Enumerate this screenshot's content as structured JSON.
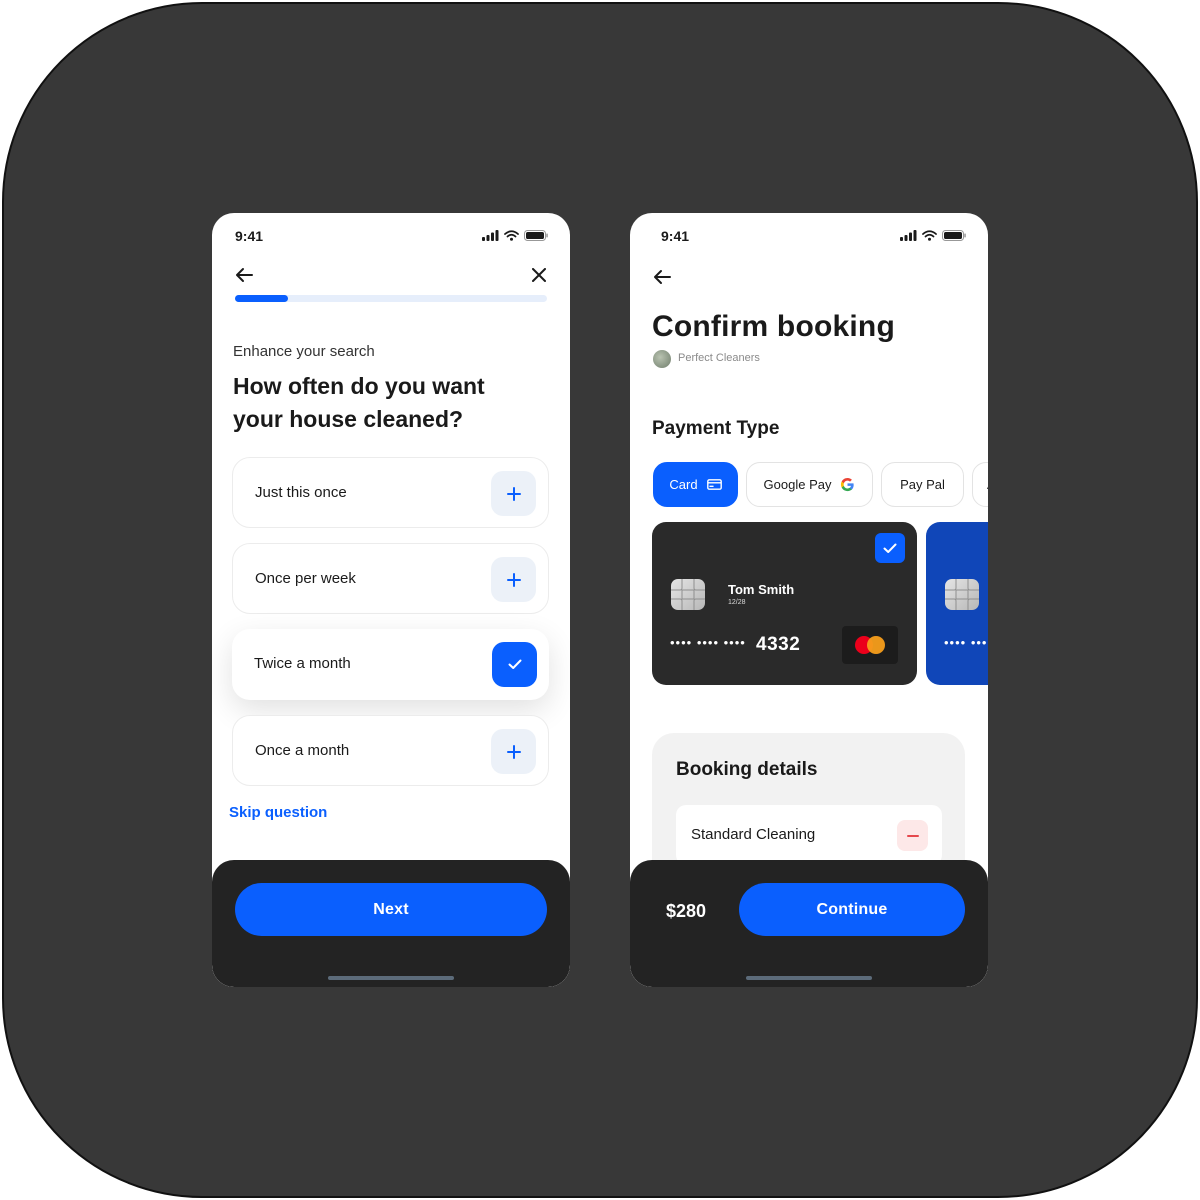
{
  "colors": {
    "accent": "#0a5ffe",
    "dark_panel": "#232323",
    "background": "#383838"
  },
  "left_phone": {
    "status_time": "9:41",
    "progress": 0.17,
    "eyebrow": "Enhance your search",
    "question": "How often do you want your house cleaned?",
    "options": [
      {
        "label": "Just this once",
        "selected": false,
        "icon": "plus-icon"
      },
      {
        "label": "Once per week",
        "selected": false,
        "icon": "plus-icon"
      },
      {
        "label": "Twice a month",
        "selected": true,
        "icon": "check-icon"
      },
      {
        "label": "Once a month",
        "selected": false,
        "icon": "plus-icon"
      }
    ],
    "skip_label": "Skip question",
    "next_label": "Next"
  },
  "right_phone": {
    "status_time": "9:41",
    "title": "Confirm booking",
    "provider": "Perfect Cleaners",
    "payment_section": "Payment Type",
    "payment_tabs": [
      {
        "label": "Card",
        "active": true,
        "icon": "credit-card-icon"
      },
      {
        "label": "Google Pay",
        "active": false,
        "icon": "google-icon"
      },
      {
        "label": "Pay Pal",
        "active": false,
        "icon": ""
      },
      {
        "label": "A",
        "active": false,
        "icon": ""
      }
    ],
    "cards": [
      {
        "holder": "Tom Smith",
        "expiry": "12/28",
        "mask": "•••• •••• ••••",
        "last4": "4332",
        "brand": "mastercard-icon",
        "selected": true
      },
      {
        "mask": "•••• ••••",
        "selected": false
      }
    ],
    "details_title": "Booking details",
    "details_items": [
      {
        "label": "Standard Cleaning"
      }
    ],
    "price": "$280",
    "continue_label": "Continue"
  }
}
